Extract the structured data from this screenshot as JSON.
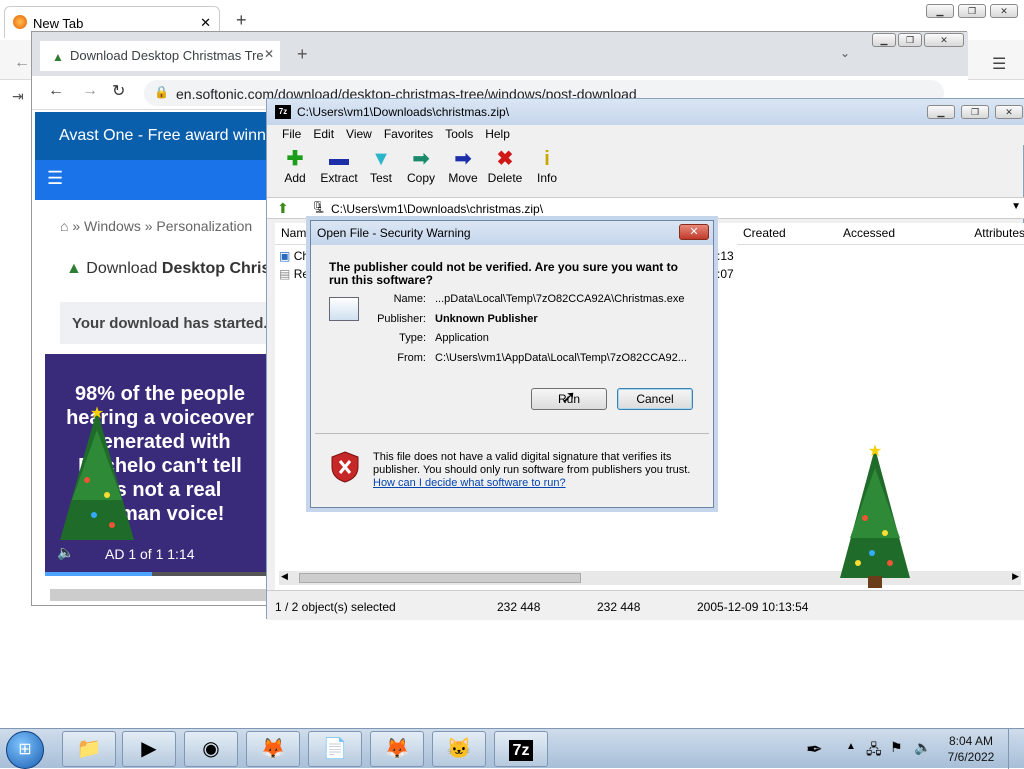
{
  "firefox": {
    "tab_title": "New Tab"
  },
  "chrome": {
    "tab_title": "Download Desktop Christmas Tre",
    "url": "en.softonic.com/download/desktop-christmas-tree/windows/post-download",
    "banner": "Avast One - Free award winning",
    "breadcrumb": [
      "Windows",
      "Personalization"
    ],
    "download_title_prefix": "Download",
    "download_title_bold": "Desktop Christ",
    "download_started": "Your download has started.",
    "ad_text": "98% of the people hearing a voiceover generated with Rachelo can't tell it's not a real human voice!",
    "video_time": "AD 1 of 1  1:14"
  },
  "sevenzip": {
    "title": "C:\\Users\\vm1\\Downloads\\christmas.zip\\",
    "menu": [
      "File",
      "Edit",
      "View",
      "Favorites",
      "Tools",
      "Help"
    ],
    "tools": [
      {
        "label": "Add",
        "icon": "add-icon",
        "glyph": "✚",
        "color": "#1a9e1a"
      },
      {
        "label": "Extract",
        "icon": "extract-icon",
        "glyph": "▬",
        "color": "#1c2fa8"
      },
      {
        "label": "Test",
        "icon": "test-icon",
        "glyph": "▼",
        "color": "#2bb5c9"
      },
      {
        "label": "Copy",
        "icon": "copy-icon",
        "glyph": "➡",
        "color": "#1a8a6a"
      },
      {
        "label": "Move",
        "icon": "move-icon",
        "glyph": "➡",
        "color": "#1c2fa8"
      },
      {
        "label": "Delete",
        "icon": "delete-icon",
        "glyph": "✖",
        "color": "#d01818"
      },
      {
        "label": "Info",
        "icon": "info-icon",
        "glyph": "i",
        "color": "#c8a800"
      }
    ],
    "path": "C:\\Users\\vm1\\Downloads\\christmas.zip\\",
    "columns": [
      "Name",
      "Created",
      "Accessed",
      "Attributes"
    ],
    "rows": [
      {
        "name": "Ch",
        "time": ":13"
      },
      {
        "name": "Re",
        "time": ":07"
      }
    ],
    "status": {
      "selected": "1 / 2 object(s) selected",
      "size": "232 448",
      "packed": "232 448",
      "modified": "2005-12-09 10:13:54"
    }
  },
  "dialog": {
    "title": "Open File - Security Warning",
    "question": "The publisher could not be verified.  Are you sure you want to run this software?",
    "fields": [
      {
        "label": "Name:",
        "value": "...pData\\Local\\Temp\\7zO82CCA92A\\Christmas.exe"
      },
      {
        "label": "Publisher:",
        "value": "Unknown Publisher"
      },
      {
        "label": "Type:",
        "value": "Application"
      },
      {
        "label": "From:",
        "value": "C:\\Users\\vm1\\AppData\\Local\\Temp\\7zO82CCA92..."
      }
    ],
    "run_label": "Run",
    "cancel_label": "Cancel",
    "warning": "This file does not have a valid digital signature that verifies its publisher.  You should only run software from publishers you trust.",
    "help_link": "How can I decide what software to run?"
  },
  "taskbar": {
    "time": "8:04 AM",
    "date": "7/6/2022",
    "apps": [
      {
        "icon": "explorer-icon",
        "glyph": "📁"
      },
      {
        "icon": "media-player-icon",
        "glyph": "▶"
      },
      {
        "icon": "chrome-icon",
        "glyph": "◉"
      },
      {
        "icon": "firefox-icon",
        "glyph": "🦊"
      },
      {
        "icon": "notepad-icon",
        "glyph": "📄"
      },
      {
        "icon": "firefox-icon",
        "glyph": "🦊"
      },
      {
        "icon": "cat-app-icon",
        "glyph": "🐱"
      },
      {
        "icon": "7zip-icon",
        "glyph": "7z"
      }
    ]
  }
}
